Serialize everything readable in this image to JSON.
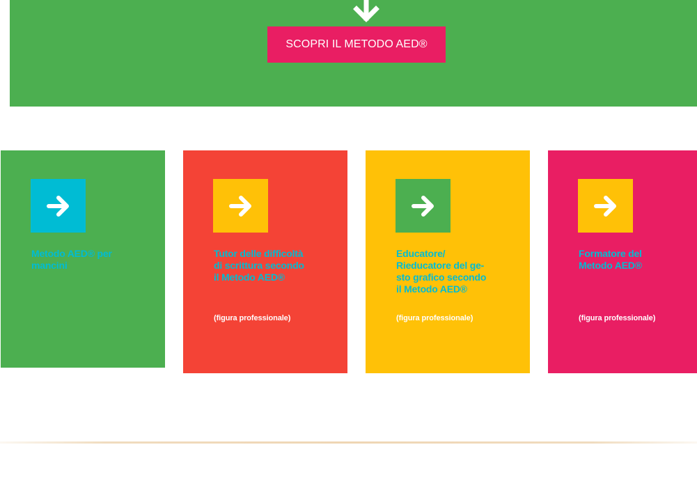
{
  "hero": {
    "background_color": "#4caf50",
    "arrow_icon": "down-arrow-icon",
    "cta_label": "SCOPRI IL METODO AED®",
    "cta_color": "#e91e63"
  },
  "cards": [
    {
      "title": "Metodo AED® per\nmancini",
      "subtitle": "",
      "background_color": "#4caf50",
      "icon_bg": "#00bcd4",
      "icon": "right-arrow-icon"
    },
    {
      "title": "Tutor delle difficoltà\ndi scrittura secondo\nil Metodo AED®",
      "subtitle": "(figura professionale)",
      "background_color": "#f44336",
      "icon_bg": "#ffc107",
      "icon": "right-arrow-icon"
    },
    {
      "title": "Educatore/\nRieducatore del ge-\nsto grafico secondo\nil Metodo AED®",
      "subtitle": "(figura professionale)",
      "background_color": "#ffc107",
      "icon_bg": "#4caf50",
      "icon": "right-arrow-icon"
    },
    {
      "title": "Formatore del\nMetodo AED®",
      "subtitle": "(figura professionale)",
      "background_color": "#e91e63",
      "icon_bg": "#ffc107",
      "icon": "right-arrow-icon"
    }
  ],
  "colors": {
    "title_text": "#00bcd4",
    "subtitle_text": "#ffffff",
    "divider": "#efd6b4"
  }
}
